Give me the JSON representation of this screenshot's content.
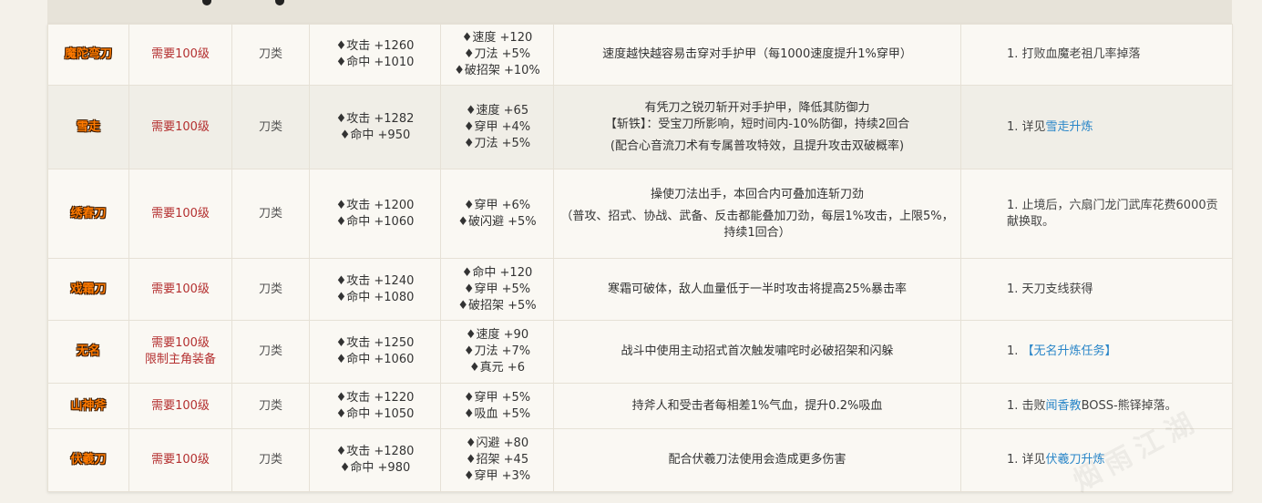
{
  "rows": [
    {
      "name": "魔陀弯刀",
      "requirement": [
        "需要100级"
      ],
      "type": "刀类",
      "main_attrs": [
        "♦攻击 +1260",
        "♦命中 +1010"
      ],
      "extra_attrs": [
        "♦速度 +120",
        "♦刀法 +5%",
        "♦破招架 +10%"
      ],
      "effect": [
        "速度越快越容易击穿对手护甲（每1000速度提升1%穿甲）"
      ],
      "source": {
        "prefix": "1. 打败血魔老祖几率掉落",
        "link": "",
        "suffix": ""
      }
    },
    {
      "name": "雪走",
      "requirement": [
        "需要100级"
      ],
      "type": "刀类",
      "main_attrs": [
        "♦攻击 +1282",
        "♦命中 +950"
      ],
      "extra_attrs": [
        "♦速度 +65",
        "♦穿甲 +4%",
        "♦刀法 +5%"
      ],
      "effect": [
        "有凭刀之锐刃斩开对手护甲，降低其防御力",
        "【斩铁】：受宝刀所影响，短时间内-10%防御，持续2回合",
        "(配合心音流刀术有专属普攻特效，且提升攻击双破概率)"
      ],
      "source": {
        "prefix": "1. 详见",
        "link": "雪走升炼",
        "suffix": ""
      }
    },
    {
      "name": "绣春刀",
      "requirement": [
        "需要100级"
      ],
      "type": "刀类",
      "main_attrs": [
        "♦攻击 +1200",
        "♦命中 +1060"
      ],
      "extra_attrs": [
        "♦穿甲 +6%",
        "♦破闪避 +5%"
      ],
      "effect": [
        "操使刀法出手，本回合内可叠加连斩刀劲",
        "（普攻、招式、协战、武备、反击都能叠加刀劲，每层1%攻击，上限5%，持续1回合）"
      ],
      "source": {
        "prefix": "1. 止境后，六扇门龙门武库花费6000贡献换取。",
        "link": "",
        "suffix": ""
      }
    },
    {
      "name": "戏霜刀",
      "requirement": [
        "需要100级"
      ],
      "type": "刀类",
      "main_attrs": [
        "♦攻击 +1240",
        "♦命中 +1080"
      ],
      "extra_attrs": [
        "♦命中 +120",
        "♦穿甲 +5%",
        "♦破招架 +5%"
      ],
      "effect": [
        "寒霜可破体，敌人血量低于一半时攻击将提高25%暴击率"
      ],
      "source": {
        "prefix": "1. 天刀支线获得",
        "link": "",
        "suffix": ""
      }
    },
    {
      "name": "无名",
      "requirement": [
        "需要100级",
        "限制主角装备"
      ],
      "type": "刀类",
      "main_attrs": [
        "♦攻击 +1250",
        "♦命中 +1060"
      ],
      "extra_attrs": [
        "♦速度 +90",
        "♦刀法 +7%",
        "♦真元 +6"
      ],
      "effect": [
        "战斗中使用主动招式首次触发嘯咤时必破招架和闪躲"
      ],
      "source": {
        "prefix": "1. ",
        "link": "【无名升炼任务】",
        "suffix": ""
      }
    },
    {
      "name": "山神斧",
      "requirement": [
        "需要100级"
      ],
      "type": "刀类",
      "main_attrs": [
        "♦攻击 +1220",
        "♦命中 +1050"
      ],
      "extra_attrs": [
        "♦穿甲 +5%",
        "♦吸血 +5%"
      ],
      "effect": [
        "持斧人和受击者每相差1%气血，提升0.2%吸血"
      ],
      "source": {
        "prefix": "1. 击败",
        "link": "闻香教",
        "suffix": "BOSS-熊铎掉落。"
      }
    },
    {
      "name": "伏羲刀",
      "requirement": [
        "需要100级"
      ],
      "type": "刀类",
      "main_attrs": [
        "♦攻击 +1280",
        "♦命中 +980"
      ],
      "extra_attrs": [
        "♦闪避 +80",
        "♦招架 +45",
        "♦穿甲 +3%"
      ],
      "effect": [
        "配合伏羲刀法使用会造成更多伤害"
      ],
      "source": {
        "prefix": "1. 详见",
        "link": "伏羲刀升炼",
        "suffix": ""
      }
    }
  ],
  "watermark": "烟雨江湖"
}
